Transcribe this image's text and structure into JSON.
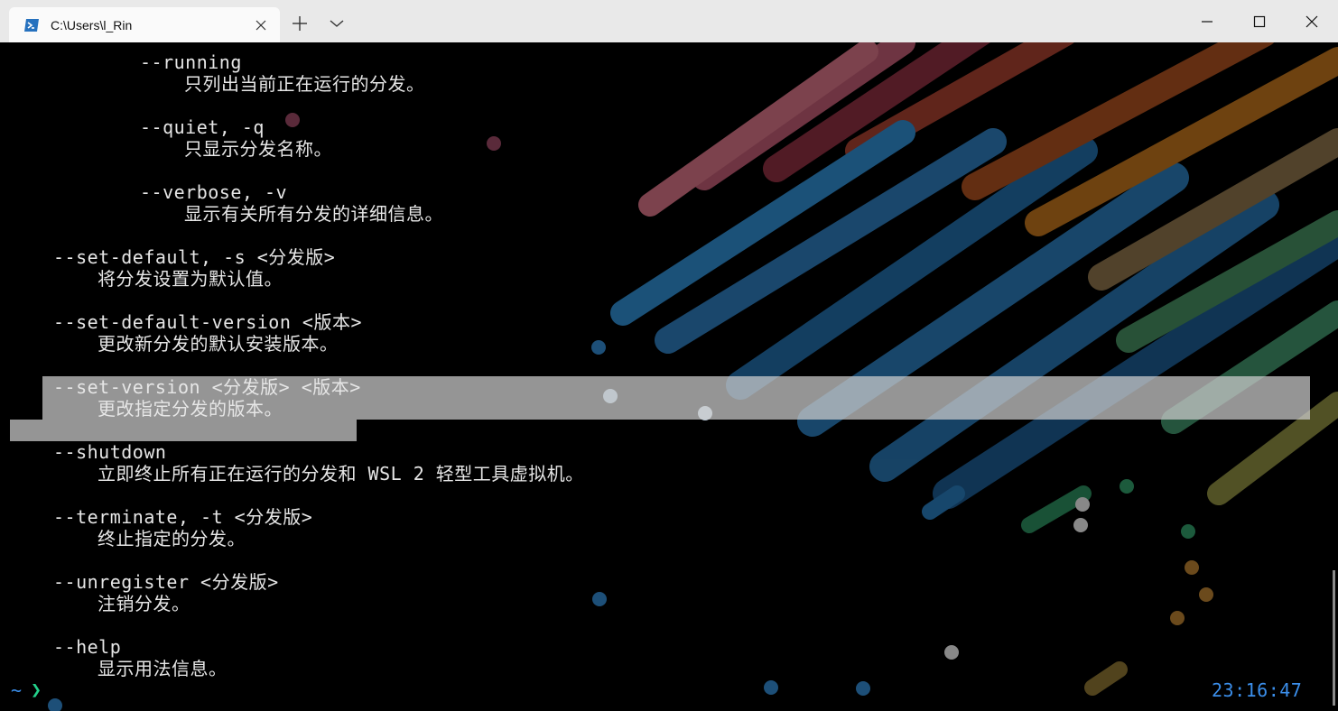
{
  "window": {
    "tab_title": "C:\\Users\\l_Rin",
    "icons": [
      "powershell-icon",
      "close-icon",
      "plus-icon",
      "chevron-down-icon",
      "minimize-icon",
      "maximize-icon",
      "close-window-icon"
    ]
  },
  "terminal": {
    "lines": [
      "--running",
      "只列出当前正在运行的分发。",
      "--quiet, -q",
      "只显示分发名称。",
      "--verbose, -v",
      "显示有关所有分发的详细信息。",
      "--set-default, -s <分发版>",
      "将分发设置为默认值。",
      "--set-default-version <版本>",
      "更改新分发的默认安装版本。",
      "--set-version <分发版> <版本>",
      "更改指定分发的版本。",
      "--shutdown",
      "立即终止所有正在运行的分发和 WSL 2 轻型工具虚拟机。",
      "--terminate, -t <分发版>",
      "终止指定的分发。",
      "--unregister <分发版>",
      "注销分发。",
      "--help",
      "显示用法信息。"
    ],
    "prompt_tilde": "~",
    "prompt_arrow": "❯",
    "clock": "23:16:47"
  },
  "colors": {
    "prompt": "#3b8eea",
    "prompt_arrow": "#23d18b",
    "selection": "#b4b4b4"
  }
}
